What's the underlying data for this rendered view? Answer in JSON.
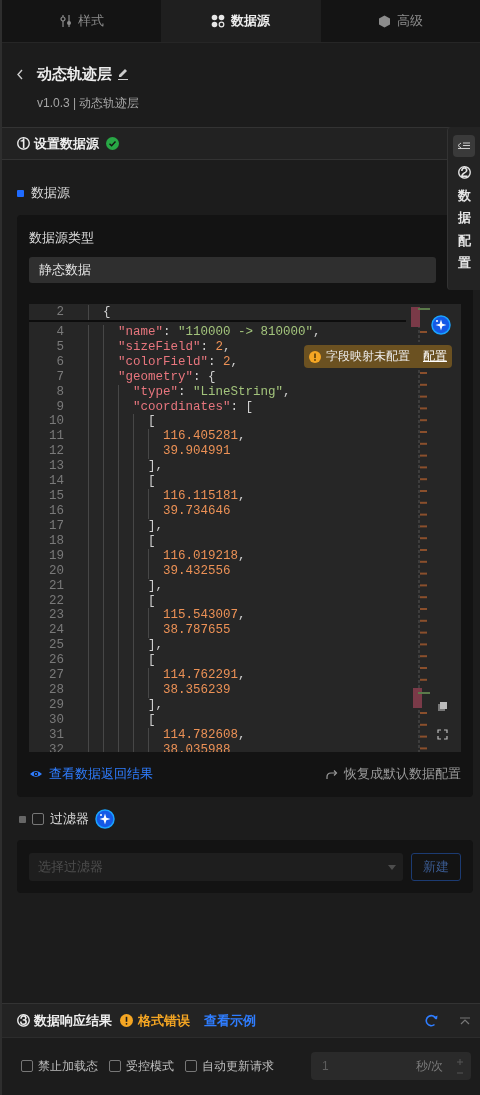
{
  "tabs": [
    {
      "label": "样式",
      "selected": false
    },
    {
      "label": "数据源",
      "selected": true
    },
    {
      "label": "高级",
      "selected": false
    }
  ],
  "header": {
    "title": "动态轨迹层",
    "subtitle": "v1.0.3 | 动态轨迹层"
  },
  "step1": {
    "title": "① 设置数据源",
    "done": true
  },
  "side_tab": {
    "label": "②数据配置"
  },
  "datasource": {
    "section_label": "数据源",
    "type_label": "数据源类型",
    "type_value": "静态数据",
    "code_lines": [
      {
        "n": "2",
        "tokens": [
          {
            "kind": "punct",
            "text": "  {"
          }
        ]
      },
      {
        "n": "4",
        "tokens": [
          {
            "kind": "key",
            "text": "    \"name\""
          },
          {
            "kind": "punct",
            "text": ": "
          },
          {
            "kind": "string",
            "text": "\"110000 -> 810000\""
          },
          {
            "kind": "punct",
            "text": ","
          }
        ]
      },
      {
        "n": "5",
        "tokens": [
          {
            "kind": "key",
            "text": "    \"sizeField\""
          },
          {
            "kind": "punct",
            "text": ": "
          },
          {
            "kind": "number",
            "text": "2"
          },
          {
            "kind": "punct",
            "text": ","
          }
        ]
      },
      {
        "n": "6",
        "tokens": [
          {
            "kind": "key",
            "text": "    \"colorField\""
          },
          {
            "kind": "punct",
            "text": ": "
          },
          {
            "kind": "number",
            "text": "2"
          },
          {
            "kind": "punct",
            "text": ","
          }
        ]
      },
      {
        "n": "7",
        "tokens": [
          {
            "kind": "key",
            "text": "    \"geometry\""
          },
          {
            "kind": "punct",
            "text": ": {"
          }
        ]
      },
      {
        "n": "8",
        "tokens": [
          {
            "kind": "key",
            "text": "      \"type\""
          },
          {
            "kind": "punct",
            "text": ": "
          },
          {
            "kind": "string",
            "text": "\"LineString\""
          },
          {
            "kind": "punct",
            "text": ","
          }
        ]
      },
      {
        "n": "9",
        "tokens": [
          {
            "kind": "key",
            "text": "      \"coordinates\""
          },
          {
            "kind": "punct",
            "text": ": ["
          }
        ]
      },
      {
        "n": "10",
        "tokens": [
          {
            "kind": "punct",
            "text": "        ["
          }
        ]
      },
      {
        "n": "11",
        "tokens": [
          {
            "kind": "number",
            "text": "          116.405281"
          },
          {
            "kind": "punct",
            "text": ","
          }
        ]
      },
      {
        "n": "12",
        "tokens": [
          {
            "kind": "number",
            "text": "          39.904991"
          }
        ]
      },
      {
        "n": "13",
        "tokens": [
          {
            "kind": "punct",
            "text": "        ],"
          }
        ]
      },
      {
        "n": "14",
        "tokens": [
          {
            "kind": "punct",
            "text": "        ["
          }
        ]
      },
      {
        "n": "15",
        "tokens": [
          {
            "kind": "number",
            "text": "          116.115181"
          },
          {
            "kind": "punct",
            "text": ","
          }
        ]
      },
      {
        "n": "16",
        "tokens": [
          {
            "kind": "number",
            "text": "          39.734646"
          }
        ]
      },
      {
        "n": "17",
        "tokens": [
          {
            "kind": "punct",
            "text": "        ],"
          }
        ]
      },
      {
        "n": "18",
        "tokens": [
          {
            "kind": "punct",
            "text": "        ["
          }
        ]
      },
      {
        "n": "19",
        "tokens": [
          {
            "kind": "number",
            "text": "          116.019218"
          },
          {
            "kind": "punct",
            "text": ","
          }
        ]
      },
      {
        "n": "20",
        "tokens": [
          {
            "kind": "number",
            "text": "          39.432556"
          }
        ]
      },
      {
        "n": "21",
        "tokens": [
          {
            "kind": "punct",
            "text": "        ],"
          }
        ]
      },
      {
        "n": "22",
        "tokens": [
          {
            "kind": "punct",
            "text": "        ["
          }
        ]
      },
      {
        "n": "23",
        "tokens": [
          {
            "kind": "number",
            "text": "          115.543007"
          },
          {
            "kind": "punct",
            "text": ","
          }
        ]
      },
      {
        "n": "24",
        "tokens": [
          {
            "kind": "number",
            "text": "          38.787655"
          }
        ]
      },
      {
        "n": "25",
        "tokens": [
          {
            "kind": "punct",
            "text": "        ],"
          }
        ]
      },
      {
        "n": "26",
        "tokens": [
          {
            "kind": "punct",
            "text": "        ["
          }
        ]
      },
      {
        "n": "27",
        "tokens": [
          {
            "kind": "number",
            "text": "          114.762291"
          },
          {
            "kind": "punct",
            "text": ","
          }
        ]
      },
      {
        "n": "28",
        "tokens": [
          {
            "kind": "number",
            "text": "          38.356239"
          }
        ]
      },
      {
        "n": "29",
        "tokens": [
          {
            "kind": "punct",
            "text": "        ],"
          }
        ]
      },
      {
        "n": "30",
        "tokens": [
          {
            "kind": "punct",
            "text": "        ["
          }
        ]
      },
      {
        "n": "31",
        "tokens": [
          {
            "kind": "number",
            "text": "          114.782608"
          },
          {
            "kind": "punct",
            "text": ","
          }
        ]
      },
      {
        "n": "32",
        "tokens": [
          {
            "kind": "number",
            "text": "          38.035988"
          }
        ]
      }
    ],
    "warning": {
      "text": "字段映射未配置",
      "action": "配置"
    },
    "view_result": "查看数据返回结果",
    "reset": "恢复成默认数据配置"
  },
  "filter": {
    "label": "过滤器",
    "checked": false,
    "placeholder": "选择过滤器",
    "new_button": "新建"
  },
  "step3": {
    "title": "③ 数据响应结果",
    "status": "格式错误",
    "example_link": "查看示例",
    "options": [
      {
        "label": "禁止加载态",
        "checked": false
      },
      {
        "label": "受控模式",
        "checked": false
      },
      {
        "label": "自动更新请求",
        "checked": false
      }
    ],
    "interval": {
      "value": "1",
      "unit": "秒/次",
      "disabled": true
    }
  }
}
